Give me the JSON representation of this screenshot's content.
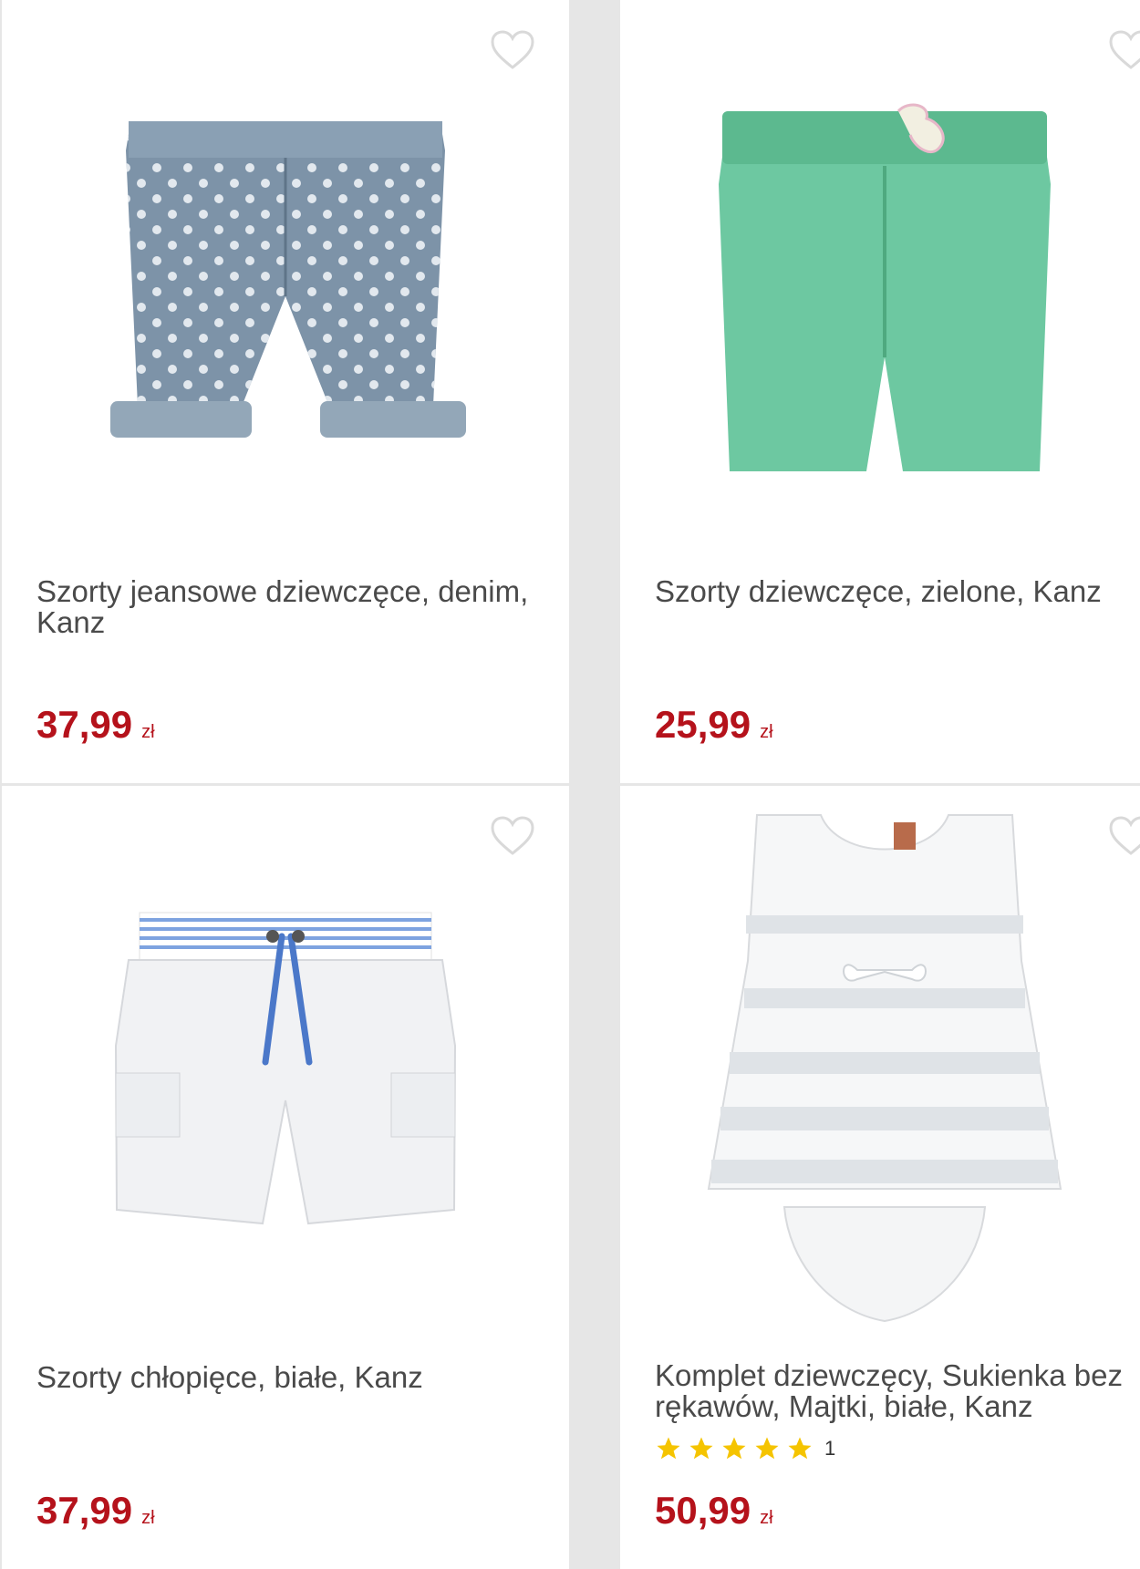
{
  "products": [
    {
      "title": "Szorty jeansowe dziewczęce, denim, Kanz",
      "price": "37,99",
      "currency": "zł"
    },
    {
      "title": "Szorty dziewczęce, zielone, Kanz",
      "price": "25,99",
      "currency": "zł"
    },
    {
      "title": "Szorty chłopięce, białe, Kanz",
      "price": "37,99",
      "currency": "zł"
    },
    {
      "title": "Komplet dziewczęcy, Sukienka bez rękawów, Majtki, białe, Kanz",
      "price": "50,99",
      "currency": "zł",
      "rating_stars": 5,
      "rating_count": "1"
    }
  ],
  "colors": {
    "price": "#b5121b",
    "star": "#f5c400",
    "heart": "#d9d9d9"
  }
}
